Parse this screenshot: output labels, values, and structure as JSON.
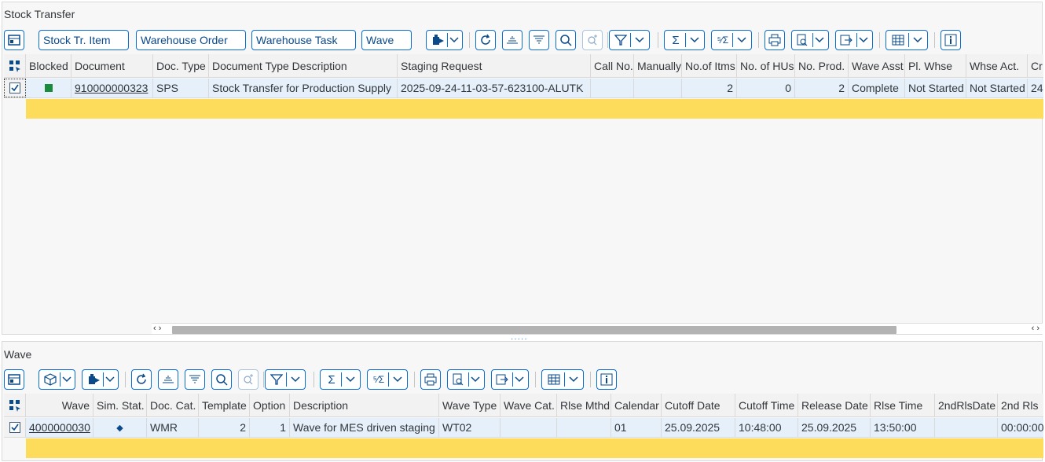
{
  "top": {
    "title": "Stock Transfer",
    "buttons": {
      "stock_tr_item": "Stock Tr. Item",
      "warehouse_order": "Warehouse Order",
      "warehouse_task": "Warehouse Task",
      "wave": "Wave"
    },
    "columns": [
      "Blocked",
      "Document",
      "Doc. Type",
      "Document Type Description",
      "Staging Request",
      "Call No.",
      "Manually",
      "No.of Itms",
      "No. of HUs",
      "No. Prod.",
      "Wave Asst",
      "Pl. Whse",
      "Whse Act.",
      "Cr"
    ],
    "rows": [
      {
        "blocked_color": "#1a8a3c",
        "document": "910000000323",
        "doc_type": "SPS",
        "doc_type_desc": "Stock Transfer for Production Supply",
        "staging_request": "2025-09-24-11-03-57-623100-ALUTK",
        "call_no": "",
        "manually": "",
        "no_of_itms": "2",
        "no_of_hus": "0",
        "no_prod": "2",
        "wave_asst": "Complete",
        "pl_whse": "Not Started",
        "whse_act": "Not Started",
        "cr": "24"
      }
    ]
  },
  "bottom": {
    "title": "Wave",
    "columns": [
      "Wave",
      "Sim. Stat.",
      "Doc. Cat.",
      "Template",
      "Option",
      "Description",
      "Wave Type",
      "Wave Cat.",
      "Rlse Mthd",
      "Calendar",
      "Cutoff Date",
      "Cutoff Time",
      "Release Date",
      "Rlse Time",
      "2ndRlsDate",
      "2nd Rls"
    ],
    "rows": [
      {
        "wave": "4000000030",
        "sim_stat": "◆",
        "doc_cat": "WMR",
        "template": "2",
        "option": "1",
        "description": "Wave for MES driven staging",
        "wave_type": "WT02",
        "wave_cat": "",
        "rlse_mthd": "",
        "calendar": "01",
        "cutoff_date": "25.09.2025",
        "cutoff_time": "10:48:00",
        "release_date": "25.09.2025",
        "rlse_time": "13:50:00",
        "second_rls_date": "",
        "second_rls": "00:00:00"
      }
    ]
  },
  "colors": {
    "accent": "#0a6ed1",
    "selected_row": "#e5f0fa",
    "highlight": "#fddc5c"
  }
}
